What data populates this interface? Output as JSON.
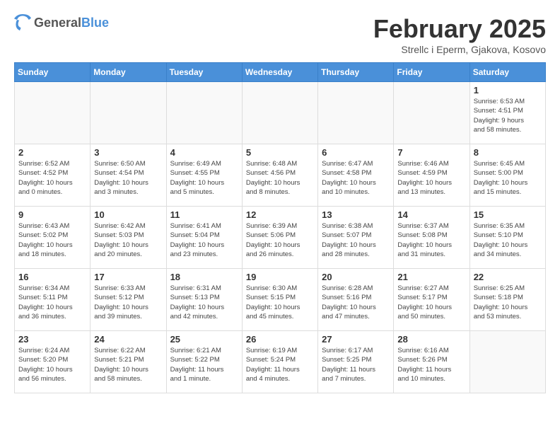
{
  "header": {
    "logo_general": "General",
    "logo_blue": "Blue",
    "title": "February 2025",
    "subtitle": "Strellc i Eperm, Gjakova, Kosovo"
  },
  "days_of_week": [
    "Sunday",
    "Monday",
    "Tuesday",
    "Wednesday",
    "Thursday",
    "Friday",
    "Saturday"
  ],
  "weeks": [
    [
      {
        "num": "",
        "info": ""
      },
      {
        "num": "",
        "info": ""
      },
      {
        "num": "",
        "info": ""
      },
      {
        "num": "",
        "info": ""
      },
      {
        "num": "",
        "info": ""
      },
      {
        "num": "",
        "info": ""
      },
      {
        "num": "1",
        "info": "Sunrise: 6:53 AM\nSunset: 4:51 PM\nDaylight: 9 hours\nand 58 minutes."
      }
    ],
    [
      {
        "num": "2",
        "info": "Sunrise: 6:52 AM\nSunset: 4:52 PM\nDaylight: 10 hours\nand 0 minutes."
      },
      {
        "num": "3",
        "info": "Sunrise: 6:50 AM\nSunset: 4:54 PM\nDaylight: 10 hours\nand 3 minutes."
      },
      {
        "num": "4",
        "info": "Sunrise: 6:49 AM\nSunset: 4:55 PM\nDaylight: 10 hours\nand 5 minutes."
      },
      {
        "num": "5",
        "info": "Sunrise: 6:48 AM\nSunset: 4:56 PM\nDaylight: 10 hours\nand 8 minutes."
      },
      {
        "num": "6",
        "info": "Sunrise: 6:47 AM\nSunset: 4:58 PM\nDaylight: 10 hours\nand 10 minutes."
      },
      {
        "num": "7",
        "info": "Sunrise: 6:46 AM\nSunset: 4:59 PM\nDaylight: 10 hours\nand 13 minutes."
      },
      {
        "num": "8",
        "info": "Sunrise: 6:45 AM\nSunset: 5:00 PM\nDaylight: 10 hours\nand 15 minutes."
      }
    ],
    [
      {
        "num": "9",
        "info": "Sunrise: 6:43 AM\nSunset: 5:02 PM\nDaylight: 10 hours\nand 18 minutes."
      },
      {
        "num": "10",
        "info": "Sunrise: 6:42 AM\nSunset: 5:03 PM\nDaylight: 10 hours\nand 20 minutes."
      },
      {
        "num": "11",
        "info": "Sunrise: 6:41 AM\nSunset: 5:04 PM\nDaylight: 10 hours\nand 23 minutes."
      },
      {
        "num": "12",
        "info": "Sunrise: 6:39 AM\nSunset: 5:06 PM\nDaylight: 10 hours\nand 26 minutes."
      },
      {
        "num": "13",
        "info": "Sunrise: 6:38 AM\nSunset: 5:07 PM\nDaylight: 10 hours\nand 28 minutes."
      },
      {
        "num": "14",
        "info": "Sunrise: 6:37 AM\nSunset: 5:08 PM\nDaylight: 10 hours\nand 31 minutes."
      },
      {
        "num": "15",
        "info": "Sunrise: 6:35 AM\nSunset: 5:10 PM\nDaylight: 10 hours\nand 34 minutes."
      }
    ],
    [
      {
        "num": "16",
        "info": "Sunrise: 6:34 AM\nSunset: 5:11 PM\nDaylight: 10 hours\nand 36 minutes."
      },
      {
        "num": "17",
        "info": "Sunrise: 6:33 AM\nSunset: 5:12 PM\nDaylight: 10 hours\nand 39 minutes."
      },
      {
        "num": "18",
        "info": "Sunrise: 6:31 AM\nSunset: 5:13 PM\nDaylight: 10 hours\nand 42 minutes."
      },
      {
        "num": "19",
        "info": "Sunrise: 6:30 AM\nSunset: 5:15 PM\nDaylight: 10 hours\nand 45 minutes."
      },
      {
        "num": "20",
        "info": "Sunrise: 6:28 AM\nSunset: 5:16 PM\nDaylight: 10 hours\nand 47 minutes."
      },
      {
        "num": "21",
        "info": "Sunrise: 6:27 AM\nSunset: 5:17 PM\nDaylight: 10 hours\nand 50 minutes."
      },
      {
        "num": "22",
        "info": "Sunrise: 6:25 AM\nSunset: 5:18 PM\nDaylight: 10 hours\nand 53 minutes."
      }
    ],
    [
      {
        "num": "23",
        "info": "Sunrise: 6:24 AM\nSunset: 5:20 PM\nDaylight: 10 hours\nand 56 minutes."
      },
      {
        "num": "24",
        "info": "Sunrise: 6:22 AM\nSunset: 5:21 PM\nDaylight: 10 hours\nand 58 minutes."
      },
      {
        "num": "25",
        "info": "Sunrise: 6:21 AM\nSunset: 5:22 PM\nDaylight: 11 hours\nand 1 minute."
      },
      {
        "num": "26",
        "info": "Sunrise: 6:19 AM\nSunset: 5:24 PM\nDaylight: 11 hours\nand 4 minutes."
      },
      {
        "num": "27",
        "info": "Sunrise: 6:17 AM\nSunset: 5:25 PM\nDaylight: 11 hours\nand 7 minutes."
      },
      {
        "num": "28",
        "info": "Sunrise: 6:16 AM\nSunset: 5:26 PM\nDaylight: 11 hours\nand 10 minutes."
      },
      {
        "num": "",
        "info": ""
      }
    ]
  ]
}
